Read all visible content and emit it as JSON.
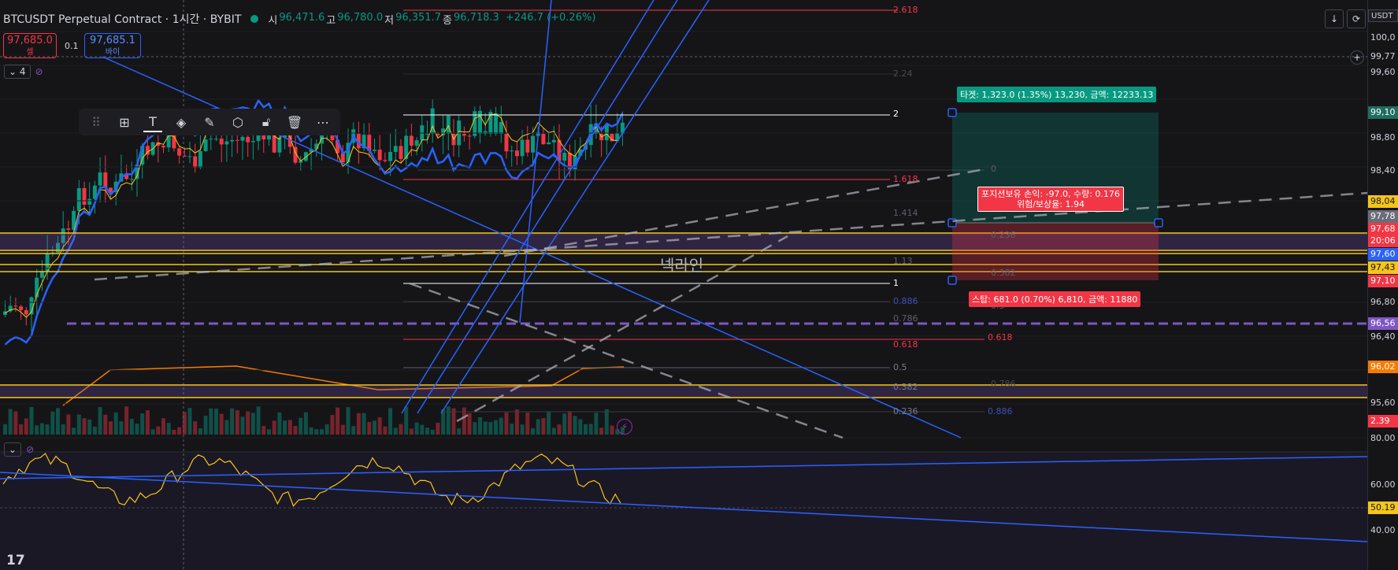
{
  "header": {
    "symbol": "BTCUSDT Perpetual Contract · 1시간 · BYBIT",
    "ohlc": [
      {
        "k": "시",
        "v": "96,471.6"
      },
      {
        "k": "고",
        "v": "96,780.0"
      },
      {
        "k": "저",
        "v": "96,351.7"
      },
      {
        "k": "종",
        "v": "96,718.3"
      }
    ],
    "change": "+246.7 (+0.26%)"
  },
  "trade": {
    "sell_price": "97,685.0",
    "sell_label": "셀",
    "spread": "0.1",
    "buy_price": "97,685.1",
    "buy_label": "바이"
  },
  "indicator_row": {
    "count": "4"
  },
  "toolbar_icons": [
    "drag-handle-icon",
    "layout-icon",
    "text-icon",
    "fill-icon",
    "brush-icon",
    "settings-icon",
    "unlock-icon",
    "trash-icon",
    "more-icon"
  ],
  "top_right": {
    "currency": "USDT",
    "btn1": "↓",
    "btn2": "⟳"
  },
  "price_axis": [
    {
      "text": "100,0",
      "bg": "",
      "color": "#d1d4dc"
    },
    {
      "text": "99,77",
      "bg": "",
      "color": "#d1d4dc"
    },
    {
      "text": "99,60",
      "bg": "",
      "color": "#d1d4dc"
    },
    {
      "text": "99,10",
      "bg": "#1e6e5e",
      "color": "#ffffff"
    },
    {
      "text": "98,80",
      "bg": "",
      "color": "#d1d4dc"
    },
    {
      "text": "98,40",
      "bg": "",
      "color": "#d1d4dc"
    },
    {
      "text": "98,04",
      "bg": "#f5c518",
      "color": "#131722"
    },
    {
      "text": "97,78",
      "bg": "#6a6d78",
      "color": "#ffffff"
    },
    {
      "text": "97,68",
      "bg": "#f23645",
      "color": "#ffffff"
    },
    {
      "text": "20:06",
      "bg": "#f23645",
      "color": "#ffffff"
    },
    {
      "text": "97,60",
      "bg": "#2962ff",
      "color": "#ffffff"
    },
    {
      "text": "97,43",
      "bg": "#f5c518",
      "color": "#131722"
    },
    {
      "text": "97,10",
      "bg": "#f23645",
      "color": "#ffffff"
    },
    {
      "text": "96,80",
      "bg": "",
      "color": "#d1d4dc"
    },
    {
      "text": "96,56",
      "bg": "#7e57c2",
      "color": "#ffffff"
    },
    {
      "text": "96,40",
      "bg": "",
      "color": "#d1d4dc"
    },
    {
      "text": "96,02",
      "bg": "#f57c00",
      "color": "#ffffff"
    },
    {
      "text": "95,60",
      "bg": "",
      "color": "#d1d4dc"
    },
    {
      "text": "2.39",
      "bg": "#f23645",
      "color": "#ffffff"
    },
    {
      "text": "80.00",
      "bg": "",
      "color": "#d1d4dc"
    },
    {
      "text": "60.00",
      "bg": "",
      "color": "#d1d4dc"
    },
    {
      "text": "50.19",
      "bg": "#f5c518",
      "color": "#131722"
    },
    {
      "text": "40.00",
      "bg": "",
      "color": "#d1d4dc"
    }
  ],
  "fib_labels": [
    {
      "text": "2.618",
      "color": "#f23645"
    },
    {
      "text": "2.24",
      "color": "#4a4a4a"
    },
    {
      "text": "2",
      "color": "#ffffff"
    },
    {
      "text": "0",
      "color": "#5d606b"
    },
    {
      "text": "1.618",
      "color": "#f23645"
    },
    {
      "text": "1.414",
      "color": "#5d606b"
    },
    {
      "text": "0.236",
      "color": "#5d606b"
    },
    {
      "text": "1.13",
      "color": "#5d606b"
    },
    {
      "text": "0.382",
      "color": "#5d606b"
    },
    {
      "text": "1",
      "color": "#ffffff"
    },
    {
      "text": "0.886",
      "color": "#3f51b5"
    },
    {
      "text": "0.5",
      "color": "#5d606b"
    },
    {
      "text": "0.786",
      "color": "#5d606b"
    },
    {
      "text": "0.618",
      "color": "#f23645"
    },
    {
      "text": "0.618",
      "color": "#f23645"
    },
    {
      "text": "0.5",
      "color": "#787b86"
    },
    {
      "text": "0.382",
      "color": "#787b86"
    },
    {
      "text": "0.786",
      "color": "#4a4a4a"
    },
    {
      "text": "0.236",
      "color": "#787b86"
    },
    {
      "text": "0.886",
      "color": "#3f51b5"
    }
  ],
  "position": {
    "target": "타겟: 1,323.0 (1.35%) 13,230, 금액: 12233.13",
    "pnl_line1": "포지션보유 손익: -97.0, 수량: 0.176",
    "pnl_line2": "위험/보상율: 1.94",
    "stop": "스탑: 681.0 (0.70%) 6,810, 금액: 11880"
  },
  "neckline_label": "넥라인",
  "logo": "17",
  "colors": {
    "up": "#089981",
    "down": "#f23645",
    "blue": "#2962ff",
    "yellow": "#f5c518",
    "orange": "#f57c00",
    "purple": "#7e57c2"
  }
}
